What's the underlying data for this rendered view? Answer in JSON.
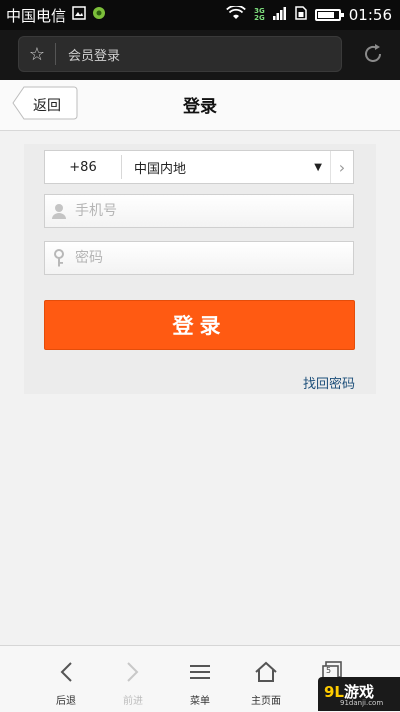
{
  "status_bar": {
    "carrier": "中国电信",
    "network_tag_top": "3G",
    "network_tag_bottom": "2G",
    "time": "01:56",
    "battery_level": 0.8
  },
  "browser": {
    "url_text": "会员登录"
  },
  "header": {
    "back_label": "返回",
    "title": "登录"
  },
  "form": {
    "country_code": "+86",
    "country_name": "中国内地",
    "phone_placeholder": "手机号",
    "password_placeholder": "密码",
    "login_label": "登录",
    "forgot_label": "找回密码"
  },
  "toolbar": {
    "items": [
      {
        "label": "后退",
        "icon": "back-arrow-icon",
        "enabled": true
      },
      {
        "label": "前进",
        "icon": "forward-arrow-icon",
        "enabled": false
      },
      {
        "label": "菜单",
        "icon": "menu-icon",
        "enabled": true
      },
      {
        "label": "主页面",
        "icon": "home-icon",
        "enabled": true
      },
      {
        "label": "",
        "icon": "tabs-icon",
        "enabled": true
      }
    ],
    "tab_count": "5"
  },
  "watermark": {
    "logo_number": "9L",
    "logo_text": "游戏",
    "url": "91danji.com"
  },
  "colors": {
    "accent": "#ff5a12",
    "link": "#1d4f7a"
  }
}
